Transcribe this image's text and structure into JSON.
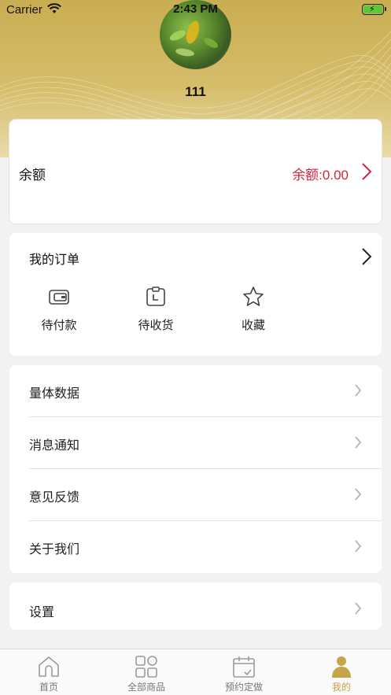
{
  "status_bar": {
    "carrier": "Carrier",
    "time": "2:43 PM"
  },
  "profile": {
    "username": "111"
  },
  "balance": {
    "label": "余额",
    "amount_text": "余额:0.00"
  },
  "orders": {
    "title": "我的订单",
    "items": [
      {
        "label": "待付款",
        "icon": "wallet-icon"
      },
      {
        "label": "待收货",
        "icon": "package-icon"
      },
      {
        "label": "收藏",
        "icon": "star-icon"
      }
    ]
  },
  "menu": {
    "items": [
      {
        "label": "量体数据"
      },
      {
        "label": "消息通知"
      },
      {
        "label": "意见反馈"
      },
      {
        "label": "关于我们"
      }
    ]
  },
  "settings": {
    "label": "设置"
  },
  "tabbar": {
    "items": [
      {
        "label": "首页",
        "icon": "home-icon"
      },
      {
        "label": "全部商品",
        "icon": "grid-icon"
      },
      {
        "label": "预约定做",
        "icon": "calendar-icon"
      },
      {
        "label": "我的",
        "icon": "user-icon"
      }
    ],
    "active_index": 3
  },
  "colors": {
    "gold": "#c9ad52",
    "accent_red": "#d0263b",
    "active_tab": "#c6a44a"
  }
}
